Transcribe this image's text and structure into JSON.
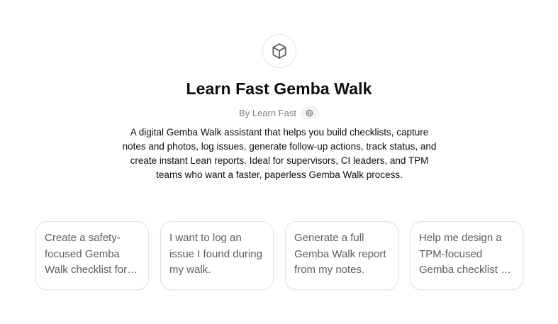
{
  "gpt": {
    "icon": "cube-icon",
    "title": "Learn Fast Gemba Walk",
    "byline": "By Learn Fast",
    "globe_icon": "globe-icon",
    "description": "A digital Gemba Walk assistant that helps you build checklists, capture notes and photos, log issues, generate follow-up actions, track status, and create instant Lean reports. Ideal for supervisors, CI leaders, and TPM teams who want a faster, paperless Gemba Walk process."
  },
  "starters": [
    {
      "label": "Create a safety-focused Gemba Walk checklist for my area."
    },
    {
      "label": "I want to log an issue I found during my walk."
    },
    {
      "label": "Generate a full Gemba Walk report from my notes."
    },
    {
      "label": "Help me design a TPM-focused Gemba checklist for my team."
    }
  ],
  "colors": {
    "background": "#ffffff",
    "text": "#0d0d0d",
    "muted": "#7d7d7d",
    "border": "#e3e3e3"
  }
}
